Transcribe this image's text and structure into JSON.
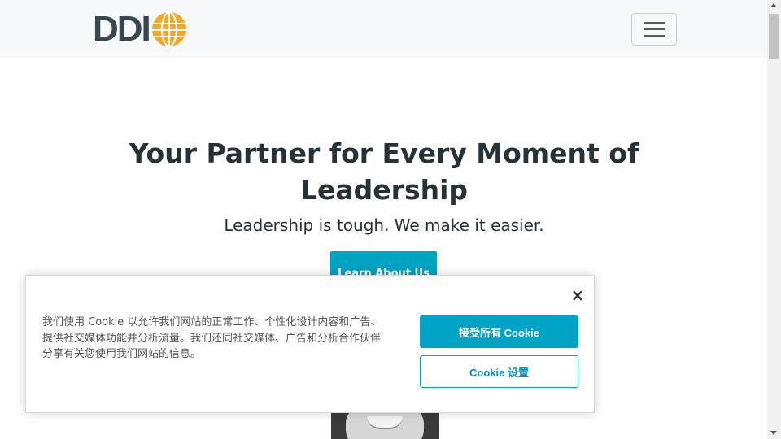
{
  "header": {
    "logo_text": "DDI",
    "logo_icon": "globe-icon",
    "menu_icon": "hamburger-menu-icon"
  },
  "hero": {
    "title": "Your Partner for Every Moment of Leadership",
    "subtitle": "Leadership is tough. We make it easier.",
    "cta_label": "Learn About Us"
  },
  "cookie_banner": {
    "text": "我们使用 Cookie 以允许我们网站的正常工作、个性化设计内容和广告、提供社交媒体功能并分析流量。我们还同社交媒体、广告和分析合作伙伴分享有关您使用我们网站的信息。",
    "accept_label": "接受所有 Cookie",
    "settings_label": "Cookie 设置",
    "close_label": "×"
  },
  "colors": {
    "accent": "#00a3c4",
    "logo_orange": "#f5a623",
    "logo_gray": "#37474f",
    "text_dark": "#263238"
  }
}
